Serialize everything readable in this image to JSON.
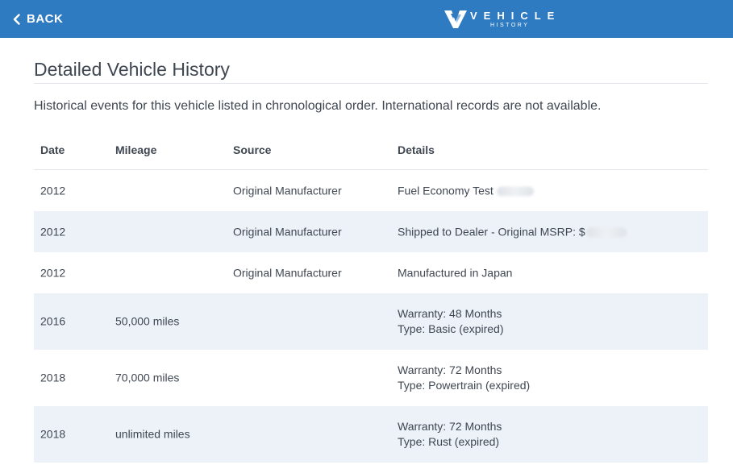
{
  "header": {
    "back_label": "BACK",
    "logo_word": "VEHICLE",
    "logo_sub": "HISTORY",
    "background_color": "#2f7bc1"
  },
  "page": {
    "title": "Detailed Vehicle History",
    "intro": "Historical events for this vehicle listed in chronological order. International records are not available."
  },
  "table": {
    "columns": {
      "date": "Date",
      "mileage": "Mileage",
      "source": "Source",
      "details": "Details"
    },
    "rows": [
      {
        "date": "2012",
        "mileage": "",
        "source": "Original Manufacturer",
        "details_1": "Fuel Economy Test",
        "details_2": ""
      },
      {
        "date": "2012",
        "mileage": "",
        "source": "Original Manufacturer",
        "details_1": "Shipped to Dealer - Original MSRP: $",
        "details_2": ""
      },
      {
        "date": "2012",
        "mileage": "",
        "source": "Original Manufacturer",
        "details_1": "Manufactured in Japan",
        "details_2": ""
      },
      {
        "date": "2016",
        "mileage": "50,000 miles",
        "source": "",
        "details_1": "Warranty: 48 Months",
        "details_2": "Type: Basic (expired)"
      },
      {
        "date": "2018",
        "mileage": "70,000 miles",
        "source": "",
        "details_1": "Warranty: 72 Months",
        "details_2": "Type: Powertrain (expired)"
      },
      {
        "date": "2018",
        "mileage": "unlimited miles",
        "source": "",
        "details_1": "Warranty: 72 Months",
        "details_2": "Type: Rust (expired)"
      }
    ]
  }
}
